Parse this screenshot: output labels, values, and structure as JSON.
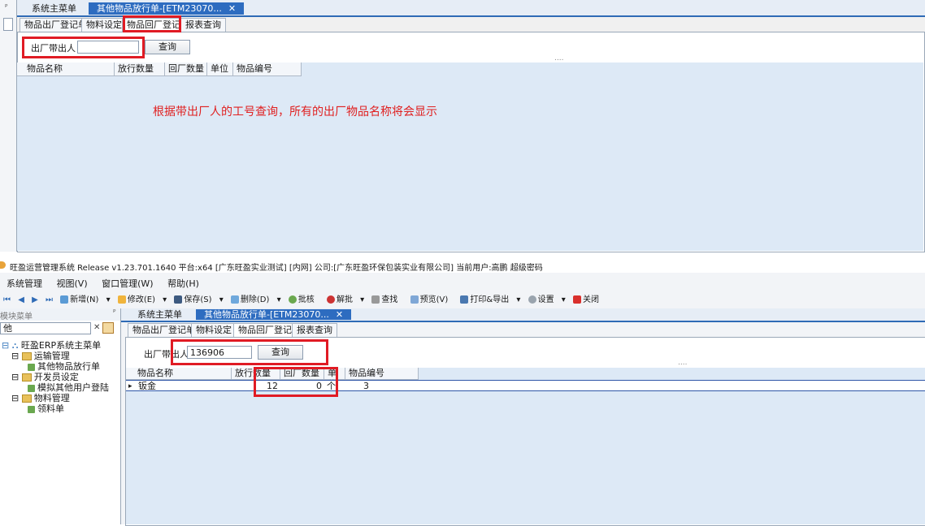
{
  "top": {
    "pin": "ᴾ",
    "tabs": [
      {
        "label": "系统主菜单"
      },
      {
        "label": "其他物品放行单-[ETM23070...",
        "close": "✕"
      }
    ],
    "subtabs": [
      "物品出厂登记单",
      "物料设定",
      "物品回厂登记",
      "报表查询"
    ],
    "form": {
      "label": "出厂带出人",
      "input_value": "",
      "query_label": "查询"
    },
    "dots": "....",
    "columns": [
      "物品名称",
      "放行数量",
      "回厂数量",
      "单位",
      "物品编号"
    ],
    "annotation": "根据带出厂人的工号查询，所有的出厂物品名称将会显示"
  },
  "bottom": {
    "title_bar": "旺盈运营管理系统 Release v1.23.701.1640 平台:x64  [广东旺盈实业测试] [内网] 公司:[广东旺盈环保包装实业有限公司] 当前用户:高鹏  超级密码",
    "menu": [
      "系统管理",
      "视图(V)",
      "窗口管理(W)",
      "帮助(H)"
    ],
    "toolbar": [
      "新增(N)",
      "修改(E)",
      "保存(S)",
      "删除(D)",
      "批核",
      "解批",
      "查找",
      "预览(V)",
      "打印&导出",
      "设置",
      "关闭"
    ],
    "sidebar": {
      "header": "模块菜单",
      "pin": "ᴾ",
      "search_value": "他",
      "tree": [
        {
          "label": "旺盈ERP系统主菜单",
          "level": 0
        },
        {
          "label": "运输管理",
          "level": 1
        },
        {
          "label": "其他物品放行单",
          "level": 2
        },
        {
          "label": "开发员设定",
          "level": 1
        },
        {
          "label": "模拟其他用户登陆",
          "level": 2
        },
        {
          "label": "物料管理",
          "level": 1
        },
        {
          "label": "领料单",
          "level": 2
        }
      ]
    },
    "tabs": [
      {
        "label": "系统主菜单"
      },
      {
        "label": "其他物品放行单-[ETM23070...",
        "close": "✕"
      }
    ],
    "subtabs": [
      "物品出厂登记单",
      "物料设定",
      "物品回厂登记",
      "报表查询"
    ],
    "form": {
      "label": "出厂带出人",
      "input_value": "136906",
      "query_label": "查询"
    },
    "dots": "....",
    "columns": [
      "物品名称",
      "放行数量",
      "回厂数量",
      "单位",
      "物品编号"
    ],
    "rows": [
      {
        "indicator": "▸",
        "name": "钣金",
        "qty": "12",
        "returned": "0",
        "unit": "个",
        "code": "3"
      }
    ]
  }
}
